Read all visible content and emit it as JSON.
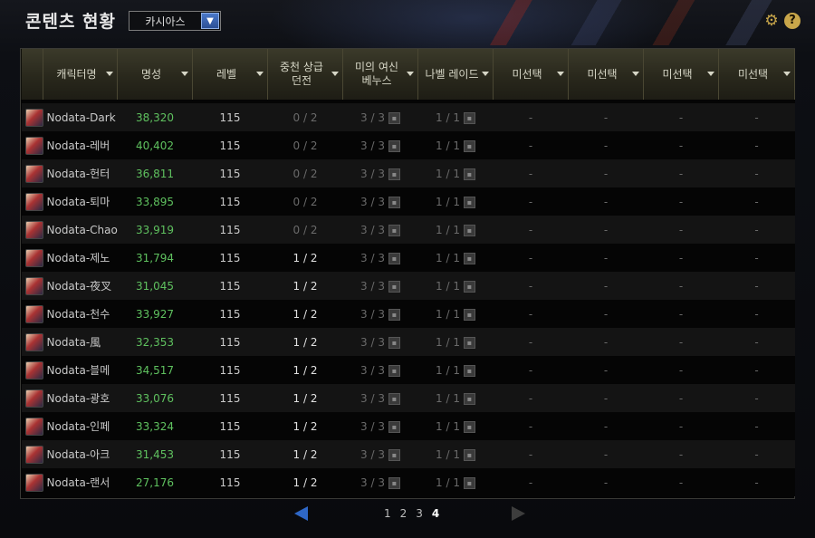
{
  "header": {
    "title": "콘텐츠 현황",
    "server_select": "카시아스",
    "settings_icon": "gear-icon",
    "help_label": "?"
  },
  "columns": [
    {
      "label": "캐릭터명"
    },
    {
      "label": "명성"
    },
    {
      "label": "레벨"
    },
    {
      "label": "중천 상급\n던전"
    },
    {
      "label": "미의 여신\n베누스"
    },
    {
      "label": "나벨 레이드"
    },
    {
      "label": "미선택"
    },
    {
      "label": "미선택"
    },
    {
      "label": "미선택"
    },
    {
      "label": "미선택"
    }
  ],
  "rows": [
    {
      "name": "Nodata-Dark",
      "fame": "38,320",
      "level": "115",
      "c1": "0 / 2",
      "c2": "3 / 3",
      "c3": "1 / 1",
      "c4": "-",
      "c5": "-",
      "c6": "-",
      "c7": "-"
    },
    {
      "name": "Nodata-레버",
      "fame": "40,402",
      "level": "115",
      "c1": "0 / 2",
      "c2": "3 / 3",
      "c3": "1 / 1",
      "c4": "-",
      "c5": "-",
      "c6": "-",
      "c7": "-"
    },
    {
      "name": "Nodata-헌터",
      "fame": "36,811",
      "level": "115",
      "c1": "0 / 2",
      "c2": "3 / 3",
      "c3": "1 / 1",
      "c4": "-",
      "c5": "-",
      "c6": "-",
      "c7": "-"
    },
    {
      "name": "Nodata-퇴마",
      "fame": "33,895",
      "level": "115",
      "c1": "0 / 2",
      "c2": "3 / 3",
      "c3": "1 / 1",
      "c4": "-",
      "c5": "-",
      "c6": "-",
      "c7": "-"
    },
    {
      "name": "Nodata-Chaos",
      "fame": "33,919",
      "level": "115",
      "c1": "0 / 2",
      "c2": "3 / 3",
      "c3": "1 / 1",
      "c4": "-",
      "c5": "-",
      "c6": "-",
      "c7": "-"
    },
    {
      "name": "Nodata-제노",
      "fame": "31,794",
      "level": "115",
      "c1": "1 / 2",
      "c2": "3 / 3",
      "c3": "1 / 1",
      "c4": "-",
      "c5": "-",
      "c6": "-",
      "c7": "-"
    },
    {
      "name": "Nodata-夜叉",
      "fame": "31,045",
      "level": "115",
      "c1": "1 / 2",
      "c2": "3 / 3",
      "c3": "1 / 1",
      "c4": "-",
      "c5": "-",
      "c6": "-",
      "c7": "-"
    },
    {
      "name": "Nodata-천수",
      "fame": "33,927",
      "level": "115",
      "c1": "1 / 2",
      "c2": "3 / 3",
      "c3": "1 / 1",
      "c4": "-",
      "c5": "-",
      "c6": "-",
      "c7": "-"
    },
    {
      "name": "Nodata-風",
      "fame": "32,353",
      "level": "115",
      "c1": "1 / 2",
      "c2": "3 / 3",
      "c3": "1 / 1",
      "c4": "-",
      "c5": "-",
      "c6": "-",
      "c7": "-"
    },
    {
      "name": "Nodata-블메",
      "fame": "34,517",
      "level": "115",
      "c1": "1 / 2",
      "c2": "3 / 3",
      "c3": "1 / 1",
      "c4": "-",
      "c5": "-",
      "c6": "-",
      "c7": "-"
    },
    {
      "name": "Nodata-광호",
      "fame": "33,076",
      "level": "115",
      "c1": "1 / 2",
      "c2": "3 / 3",
      "c3": "1 / 1",
      "c4": "-",
      "c5": "-",
      "c6": "-",
      "c7": "-"
    },
    {
      "name": "Nodata-인페",
      "fame": "33,324",
      "level": "115",
      "c1": "1 / 2",
      "c2": "3 / 3",
      "c3": "1 / 1",
      "c4": "-",
      "c5": "-",
      "c6": "-",
      "c7": "-"
    },
    {
      "name": "Nodata-아크",
      "fame": "31,453",
      "level": "115",
      "c1": "1 / 2",
      "c2": "3 / 3",
      "c3": "1 / 1",
      "c4": "-",
      "c5": "-",
      "c6": "-",
      "c7": "-"
    },
    {
      "name": "Nodata-랜서",
      "fame": "27,176",
      "level": "115",
      "c1": "1 / 2",
      "c2": "3 / 3",
      "c3": "1 / 1",
      "c4": "-",
      "c5": "-",
      "c6": "-",
      "c7": "-"
    }
  ],
  "pagination": {
    "pages": [
      "1",
      "2",
      "3",
      "4"
    ],
    "current": "4"
  },
  "colors": {
    "fame": "#5fc15f",
    "accent_blue": "#2e67c7",
    "gold_icon": "#c8a64a"
  }
}
